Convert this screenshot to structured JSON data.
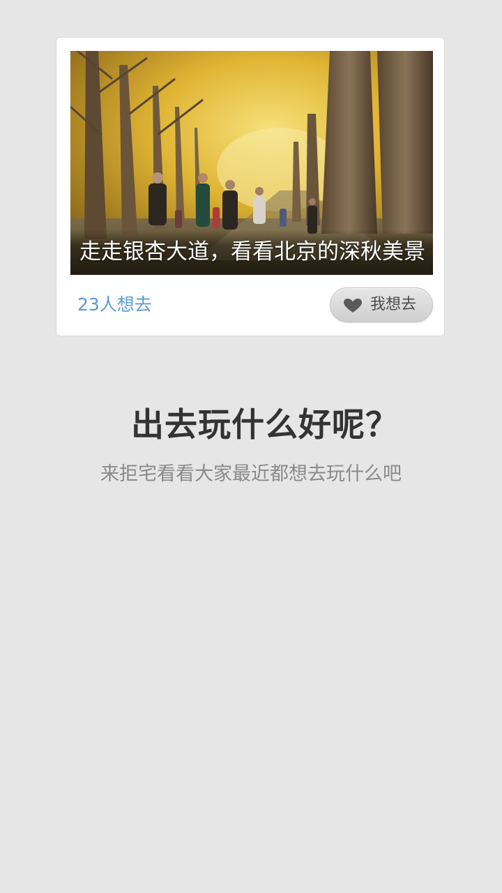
{
  "card": {
    "caption": "走走银杏大道，看看北京的深秋美景",
    "count_text": "23人想去",
    "want_button": {
      "label": "我想去",
      "icon": "heart-icon"
    },
    "image": {
      "subject": "ginkgo-avenue-photo"
    }
  },
  "empty_state": {
    "title": "出去玩什么好呢？",
    "subtitle": "来拒宅看看大家最近都想去玩什么吧"
  },
  "colors": {
    "background": "#e6e6e6",
    "card": "#ffffff",
    "count": "#5b9bd5",
    "title": "#333333",
    "subtitle": "#8a8a8a",
    "button": "#d8d8d8"
  }
}
